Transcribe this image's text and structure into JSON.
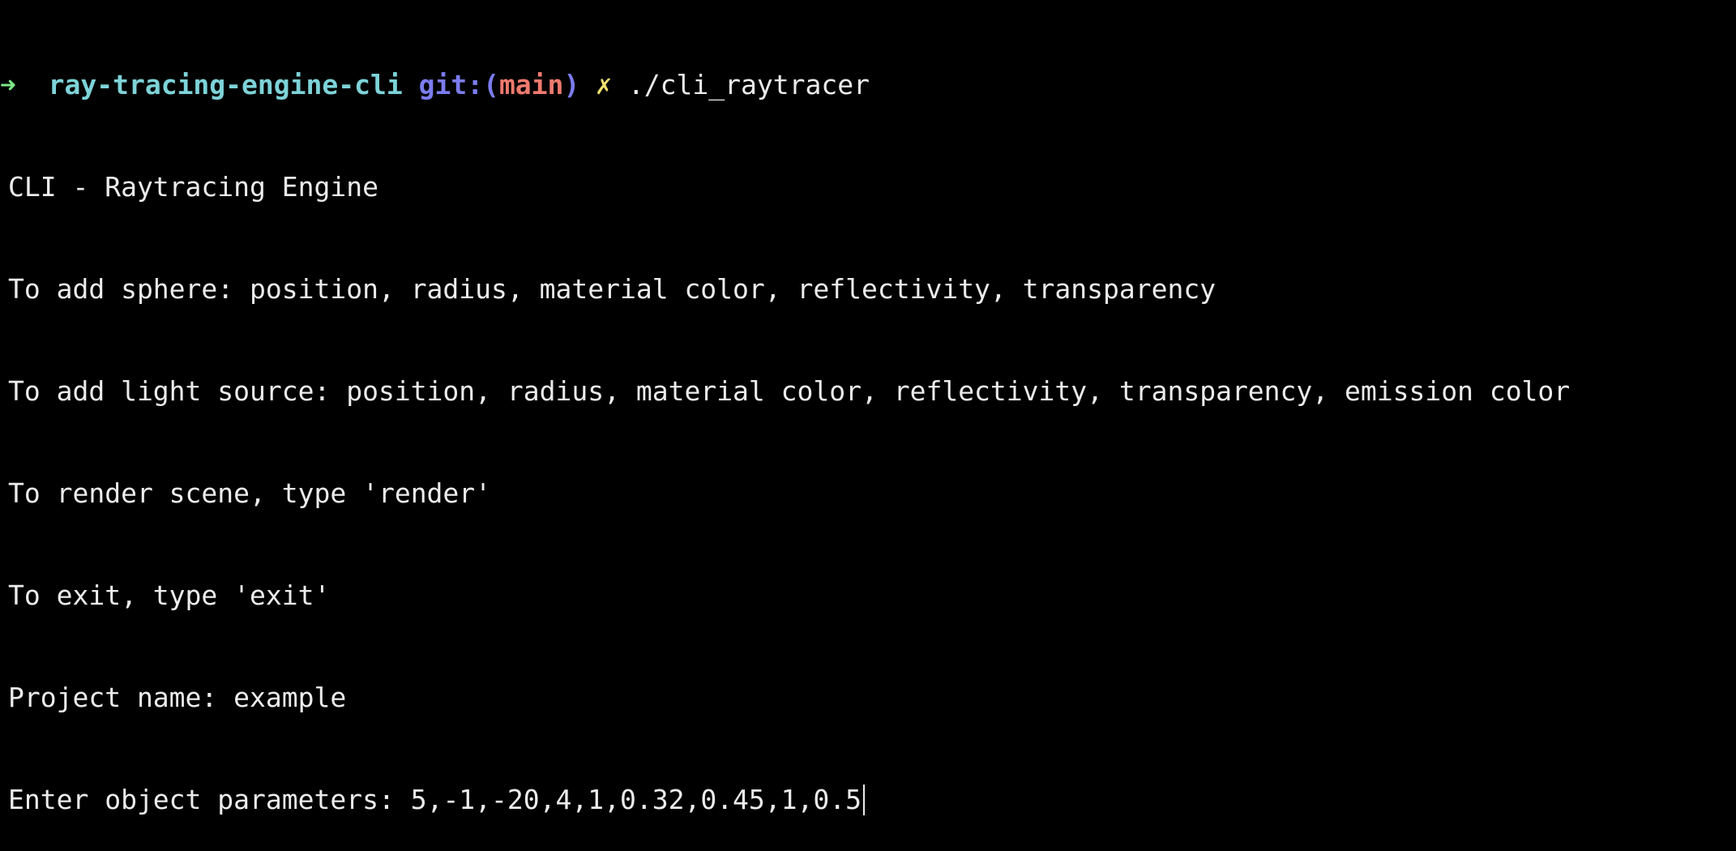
{
  "prompt": {
    "arrow": "➜",
    "directory": "ray-tracing-engine-cli",
    "git_label": "git:(",
    "branch": "main",
    "git_close": ")",
    "dirty_marker": "✗",
    "command": "./cli_raytracer"
  },
  "output": {
    "line1": "CLI - Raytracing Engine",
    "line2": "To add sphere: position, radius, material color, reflectivity, transparency",
    "line3": "To add light source: position, radius, material color, reflectivity, transparency, emission color",
    "line4": "To render scene, type 'render'",
    "line5": "To exit, type 'exit'",
    "line6": "Project name: example"
  },
  "input": {
    "label": "Enter object parameters: ",
    "value": "5,-1,-20,4,1,0.32,0.45,1,0.5"
  },
  "colors": {
    "background": "#000000",
    "text": "#ececec",
    "arrow": "#7ee787",
    "directory": "#7dd3d8",
    "git_label": "#7c7cf0",
    "branch": "#f07a6e",
    "dirty": "#f0e06e"
  }
}
